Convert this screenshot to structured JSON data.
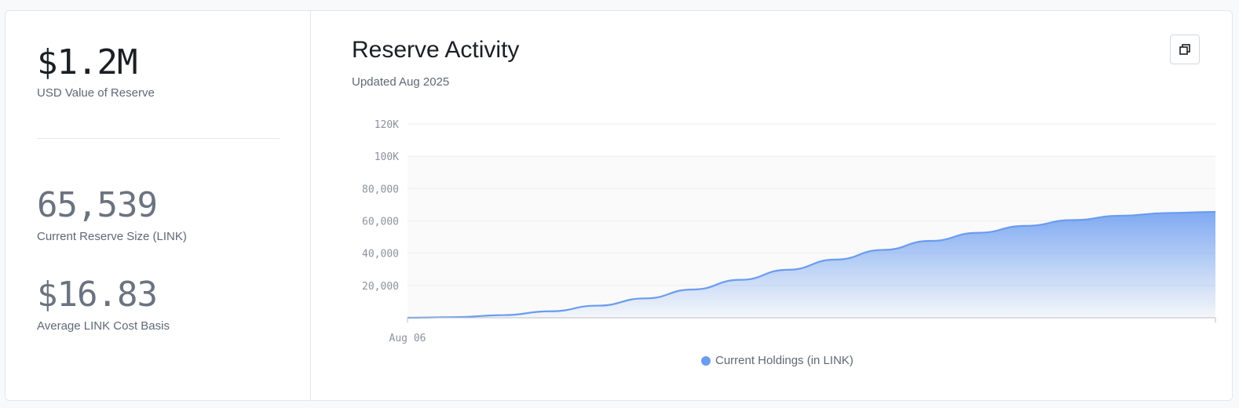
{
  "stats": {
    "usd_value": "$1.2M",
    "usd_label": "USD Value of Reserve",
    "reserve_size": "65,539",
    "reserve_label": "Current Reserve Size (LINK)",
    "cost_basis": "$16.83",
    "cost_label": "Average LINK Cost Basis"
  },
  "chart_header": {
    "title": "Reserve Activity",
    "subtitle": "Updated Aug 2025",
    "copy_icon": "copy-icon"
  },
  "colors": {
    "series": "#6a9cf0",
    "accent": "#5b8def"
  },
  "chart_data": {
    "type": "area",
    "title": "Reserve Activity",
    "xlabel": "",
    "ylabel": "",
    "ylim": [
      0,
      120000
    ],
    "y_ticks": [
      "20,000",
      "40,000",
      "60,000",
      "80,000",
      "100K",
      "120K"
    ],
    "y_tick_values": [
      20000,
      40000,
      60000,
      80000,
      100000,
      120000
    ],
    "x_tick_labels": [
      "Aug 06"
    ],
    "grid": true,
    "legend": "bottom",
    "series": [
      {
        "name": "Current Holdings (in LINK)",
        "values": [
          0,
          400,
          1600,
          4000,
          7500,
          12000,
          17500,
          23500,
          29700,
          36000,
          42000,
          47600,
          52600,
          56900,
          60500,
          63200,
          64900,
          65539
        ]
      }
    ]
  }
}
